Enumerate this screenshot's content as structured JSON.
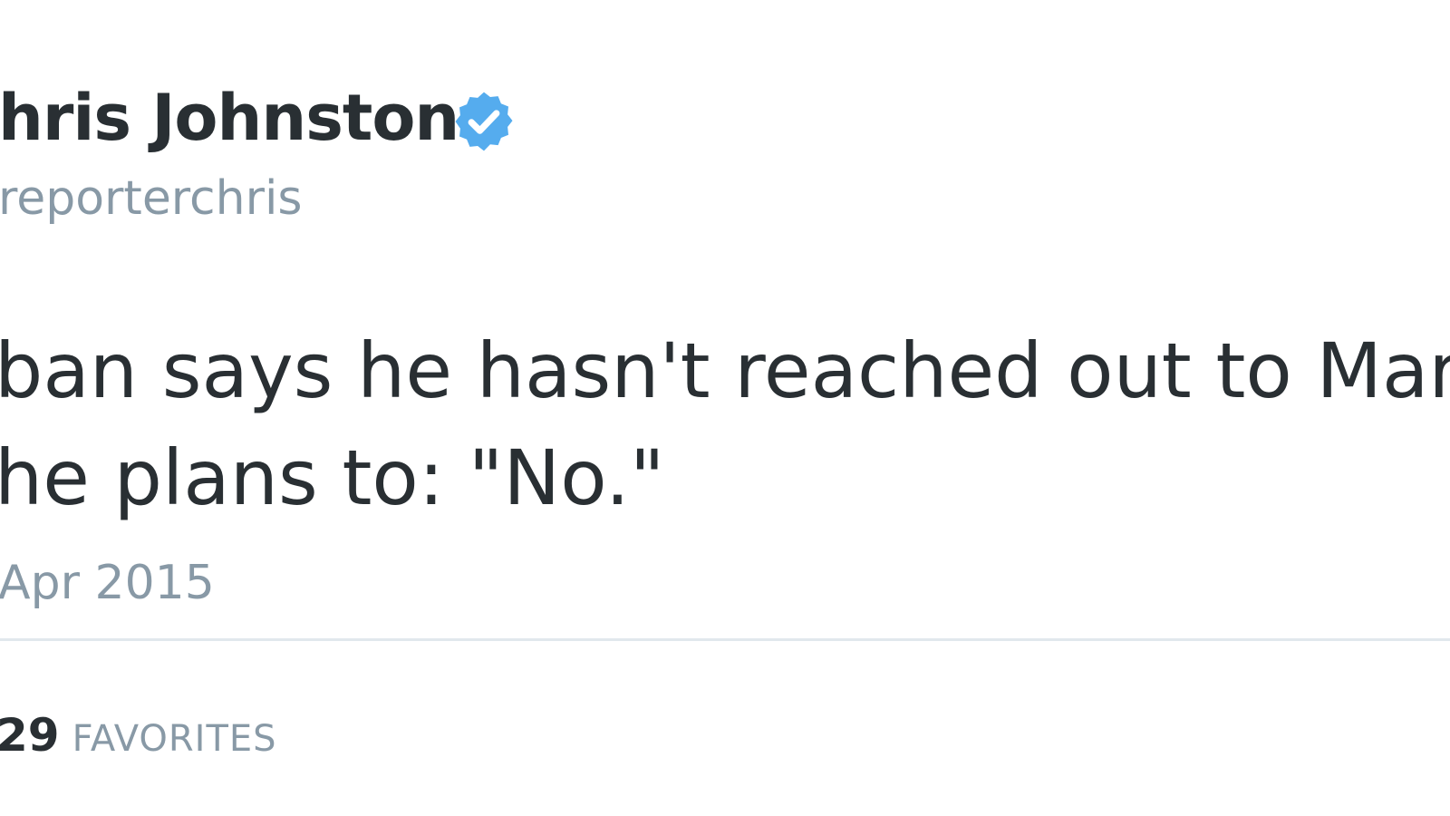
{
  "tweet": {
    "author": {
      "display_name": "hris Johnston",
      "username": "reporterchris",
      "verified_icon": "verified-badge-icon",
      "verified_color": "#55acee"
    },
    "text_lines": [
      "ban says he hasn't reached out to Mark St",
      "he plans to: \"No.\""
    ],
    "timestamp": "Apr 2015",
    "stats": {
      "favorites_count": "29",
      "favorites_label": "FAVORITES"
    }
  }
}
